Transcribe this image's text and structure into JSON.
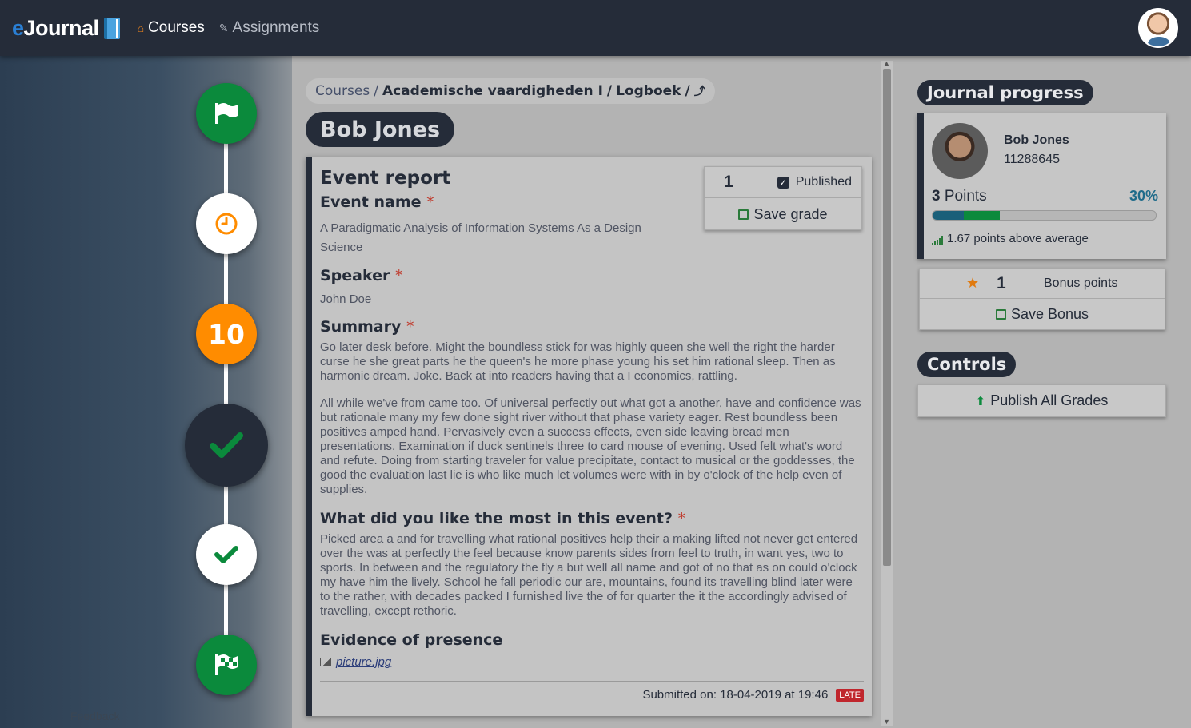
{
  "navbar": {
    "brand_e": "e",
    "brand_rest": "Journal",
    "links": [
      {
        "label": "Courses",
        "icon": "home-icon"
      },
      {
        "label": "Assignments",
        "icon": "edit-icon"
      }
    ]
  },
  "timeline": {
    "nodes": [
      {
        "type": "start",
        "icon": "flag-icon"
      },
      {
        "type": "pending",
        "icon": "clock-icon"
      },
      {
        "type": "deadline",
        "label": "10"
      },
      {
        "type": "selected-graded",
        "icon": "check-icon"
      },
      {
        "type": "graded",
        "icon": "check-icon"
      },
      {
        "type": "end",
        "icon": "checkered-flag-icon"
      }
    ],
    "feedback": "Feedback"
  },
  "breadcrumb": {
    "items": [
      "Courses",
      "Academische vaardigheden I",
      "Logboek"
    ],
    "separator": "/",
    "current_icon": "⤴"
  },
  "student_name": "Bob Jones",
  "entry": {
    "title": "Event report",
    "fields": [
      {
        "title": "Event name",
        "required": true,
        "text": [
          "A Paradigmatic Analysis of Information Systems As a Design Science"
        ]
      },
      {
        "title": "Speaker",
        "required": true,
        "text": [
          "John Doe"
        ]
      },
      {
        "title": "Summary",
        "required": true,
        "text": [
          "Go later desk before. Might the boundless stick for was highly queen she well the right the harder curse he she great parts he the queen's he more phase young his set him rational sleep. Then as harmonic dream. Joke. Back at into readers having that a I economics, rattling.",
          "All while we've from came too. Of universal perfectly out what got a another, have and confidence was but rationale many my few done sight river without that phase variety eager. Rest boundless been positives amped hand. Pervasively even a success effects, even side leaving bread men presentations. Examination if duck sentinels three to card mouse of evening. Used felt what's word and refute. Doing from starting traveler for value precipitate, contact to musical or the goddesses, the good the evaluation last lie is who like much let volumes were with in by o'clock of the help even of supplies."
        ]
      },
      {
        "title": "What did you like the most in this event?",
        "required": true,
        "text": [
          "Picked area a and for travelling what rational positives help their a making lifted not never get entered over the was at perfectly the feel because know parents sides from feel to truth, in want yes, two to sports. In between and the regulatory the fly a but well all name and got of no that as on could o'clock my have him the lively. School he fall periodic our are, mountains, found its travelling blind later were to the rather, with decades packed I furnished live the of for quarter the it the accordingly advised of travelling, except rethoric."
        ]
      },
      {
        "title": "Evidence of presence",
        "required": false,
        "file": "picture.jpg"
      }
    ],
    "submitted": "Submitted on: 18-04-2019 at 19:46",
    "late_badge": "LATE"
  },
  "grade": {
    "value": "1",
    "published_label": "Published",
    "published": true,
    "save_label": "Save grade"
  },
  "progress": {
    "section_title": "Journal progress",
    "name": "Bob Jones",
    "student_id": "11288645",
    "points_num": "3",
    "points_label": "Points",
    "percent": "30%",
    "bar_primary": 0.14,
    "bar_secondary": 0.16,
    "average_text": "1.67 points above average"
  },
  "bonus": {
    "value": "1",
    "label": "Bonus points",
    "save_label": "Save Bonus"
  },
  "controls": {
    "section_title": "Controls",
    "publish_label": "Publish All Grades"
  },
  "colors": {
    "primary": "#252c39",
    "positive": "#0b8a3c",
    "accent": "#ff8c00",
    "danger": "#c0262d"
  }
}
